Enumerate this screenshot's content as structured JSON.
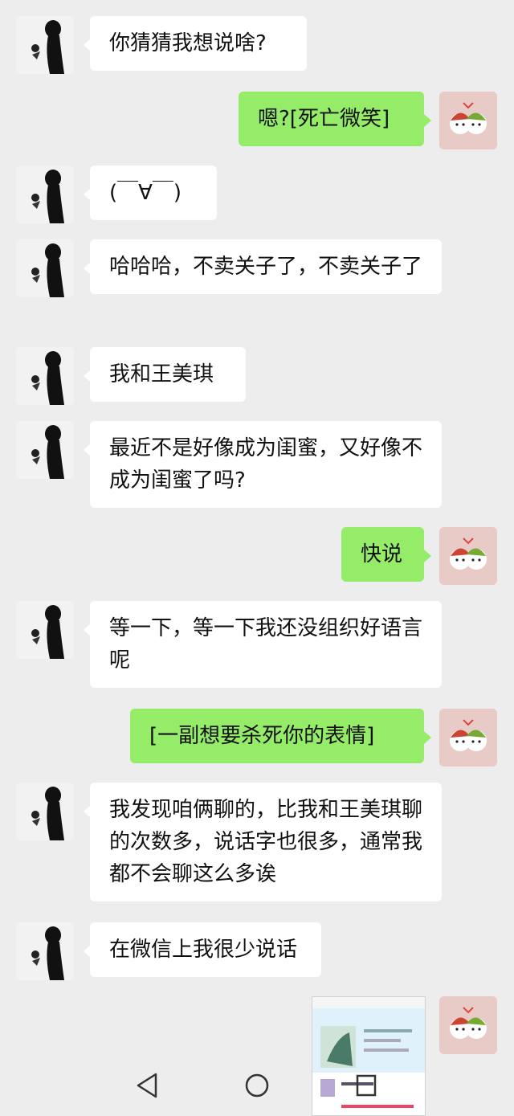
{
  "messages": [
    {
      "side": "left",
      "text": "你猜猜我想说啥?"
    },
    {
      "side": "right",
      "text": "嗯?[死亡微笑]"
    },
    {
      "side": "left",
      "text": "(￣∀￣)"
    },
    {
      "side": "left",
      "text": "哈哈哈，不卖关子了，不卖关子了"
    },
    {
      "side": "left",
      "text": "我和王美琪"
    },
    {
      "side": "left",
      "text": "最近不是好像成为闺蜜，又好像不成为闺蜜了吗?"
    },
    {
      "side": "right",
      "text": "快说"
    },
    {
      "side": "left",
      "text": "等一下，等一下我还没组织好语言呢"
    },
    {
      "side": "right",
      "text": "[一副想要杀死你的表情]"
    },
    {
      "side": "left",
      "text": "我发现咱俩聊的，比我和王美琪聊的次数多，说话字也很多，通常我都不会聊这么多诶"
    },
    {
      "side": "left",
      "text": "在微信上我很少说话"
    }
  ],
  "image_message": {
    "side": "right",
    "content": "screenshot-image"
  },
  "nav": {
    "back": "back-icon",
    "home": "home-icon",
    "recents": "recents-icon"
  },
  "colors": {
    "background": "#ededed",
    "incoming": "#ffffff",
    "outgoing": "#95ec69"
  }
}
